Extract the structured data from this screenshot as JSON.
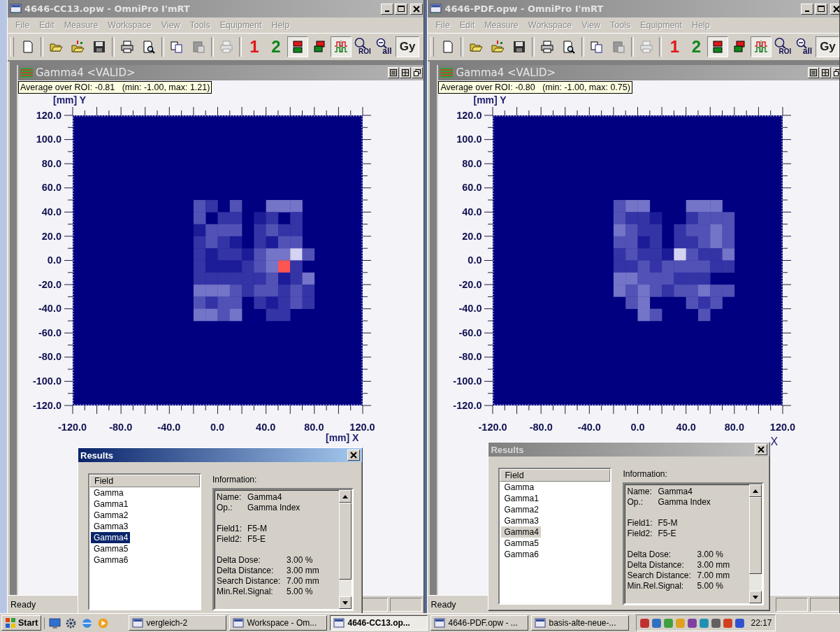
{
  "windows": [
    {
      "title": "4646-CC13.opw - OmniPro I'mRT",
      "menu": [
        "File",
        "Edit",
        "Measure",
        "Workspace",
        "View",
        "Tools",
        "Equipment",
        "Help"
      ],
      "toolbar": {
        "numbers": [
          {
            "label": "1",
            "color": "#e01818"
          },
          {
            "label": "2",
            "color": "#10861c"
          }
        ],
        "roi": "ROI",
        "zoom_all": "all",
        "unit": "Gy",
        "split_pressed": true,
        "wave_pressed": true,
        "unit_pressed": true
      },
      "child": {
        "title": "Gamma4 <VALID>",
        "tooltip": "Average over ROI: -0.81   (min: -1.00, max: 1.21)",
        "y_axis_label": "[mm] Y",
        "x_axis_label": "[mm] X",
        "yticks": [
          "120.0",
          "100.0",
          "80.0",
          "60.0",
          "40.0",
          "20.0",
          "0.0",
          "-20.0",
          "-40.0",
          "-60.0",
          "-80.0",
          "-100.0",
          "-120.0"
        ],
        "xticks": [
          "-120.0",
          "-80.0",
          "-40.0",
          "0.0",
          "40.0",
          "80.0",
          "120.0"
        ]
      },
      "results": {
        "title": "Results",
        "active": true,
        "list_header": "Field",
        "items": [
          {
            "label": "Gamma",
            "selected": false
          },
          {
            "label": "Gamma1",
            "selected": false
          },
          {
            "label": "Gamma2",
            "selected": false
          },
          {
            "label": "Gamma3",
            "selected": false
          },
          {
            "label": "Gamma4",
            "selected": true
          },
          {
            "label": "Gamma5",
            "selected": false
          },
          {
            "label": "Gamma6",
            "selected": false
          }
        ],
        "info_label": "Information:",
        "info_groups": [
          [
            {
              "label": "Name:",
              "value": "Gamma4"
            },
            {
              "label": "Op.:",
              "value": "Gamma Index"
            }
          ],
          [
            {
              "label": "Field1:",
              "value": "F5-M"
            },
            {
              "label": "Field2:",
              "value": "F5-E"
            }
          ],
          [
            {
              "label": "Delta Dose:",
              "value": "3.00 %"
            },
            {
              "label": "Delta Distance:",
              "value": "3.00 mm"
            },
            {
              "label": "Search Distance:",
              "value": "7.00 mm"
            },
            {
              "label": "Min.Rel.Signal:",
              "value": "5.00 %"
            }
          ]
        ]
      },
      "status": "Ready"
    },
    {
      "title": "4646-PDF.opw - OmniPro I'mRT",
      "menu": [
        "File",
        "Edit",
        "Measure",
        "Workspace",
        "View",
        "Tools",
        "Equipment",
        "Help"
      ],
      "toolbar": {
        "numbers": [
          {
            "label": "1",
            "color": "#e01818"
          },
          {
            "label": "2",
            "color": "#10861c"
          }
        ],
        "roi": "ROI",
        "zoom_all": "all",
        "unit": "Gy",
        "split_pressed": true,
        "wave_pressed": true,
        "unit_pressed": true
      },
      "child": {
        "title": "Gamma4 <VALID>",
        "tooltip": "Average over ROI: -0.80   (min: -1.00, max: 0.75)",
        "y_axis_label": "[mm] Y",
        "x_axis_label": "X",
        "yticks": [
          "120.0",
          "100.0",
          "80.0",
          "60.0",
          "40.0",
          "20.0",
          "0.0",
          "-20.0",
          "-40.0",
          "-60.0",
          "-80.0",
          "-100.0",
          "-120.0"
        ],
        "xticks": [
          "-120.0",
          "-80.0",
          "-40.0",
          "0.0",
          "40.0",
          "80.0",
          "120.0"
        ]
      },
      "results": {
        "title": "Results",
        "active": false,
        "list_header": "Field",
        "items": [
          {
            "label": "Gamma",
            "selected": false
          },
          {
            "label": "Gamma1",
            "selected": false
          },
          {
            "label": "Gamma2",
            "selected": false
          },
          {
            "label": "Gamma3",
            "selected": false
          },
          {
            "label": "Gamma4",
            "selected": true
          },
          {
            "label": "Gamma5",
            "selected": false
          },
          {
            "label": "Gamma6",
            "selected": false
          }
        ],
        "info_label": "Information:",
        "info_groups": [
          [
            {
              "label": "Name:",
              "value": "Gamma4"
            },
            {
              "label": "Op.:",
              "value": "Gamma Index"
            }
          ],
          [
            {
              "label": "Field1:",
              "value": "F5-M"
            },
            {
              "label": "Field2:",
              "value": "F5-E"
            }
          ],
          [
            {
              "label": "Delta Dose:",
              "value": "3.00 %"
            },
            {
              "label": "Delta Distance:",
              "value": "3.00 mm"
            },
            {
              "label": "Search Distance:",
              "value": "7.00 mm"
            },
            {
              "label": "Min.Rel.Signal:",
              "value": "5.00 %"
            }
          ]
        ]
      },
      "status": "Ready"
    }
  ],
  "taskbar": {
    "start": "Start",
    "tasks": [
      {
        "label": "vergleich-2",
        "selected": false
      },
      {
        "label": "Workspace - Om...",
        "selected": false
      },
      {
        "label": "4646-CC13.op...",
        "selected": true
      },
      {
        "label": "4646-PDF.opw - ...",
        "selected": false
      },
      {
        "label": "basis-alte-neue-...",
        "selected": false
      }
    ],
    "clock": "22:17"
  }
}
